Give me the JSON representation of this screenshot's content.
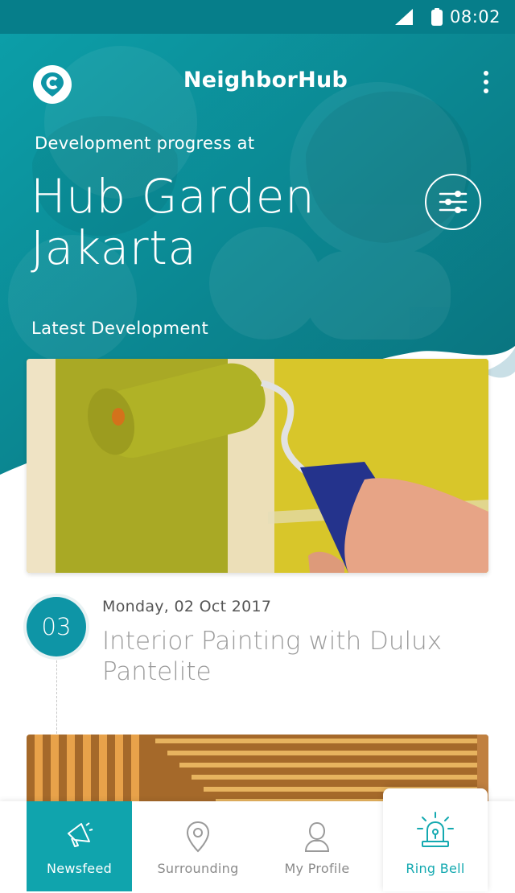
{
  "status_bar": {
    "time": "08:02"
  },
  "header": {
    "app_name": "NeighborHub"
  },
  "hero": {
    "subtitle": "Development progress at",
    "location_line1": "Hub Garden",
    "location_line2": "Jakarta"
  },
  "feed": {
    "section_title": "Latest Development",
    "posts": [
      {
        "day": "03",
        "date": "Monday, 02 Oct 2017",
        "title": "Interior Painting with Dulux Pantelite"
      }
    ]
  },
  "bottom_nav": {
    "items": [
      {
        "label": "Newsfeed",
        "icon": "megaphone-icon",
        "active": true
      },
      {
        "label": "Surrounding",
        "icon": "map-pin-icon"
      },
      {
        "label": "My Profile",
        "icon": "user-icon"
      },
      {
        "label": "Ring Bell",
        "icon": "alarm-siren-icon"
      }
    ]
  },
  "colors": {
    "primary": "#0e95a6",
    "teal_dark": "#067e8a",
    "teal_light": "#10a4ad",
    "bell_accent": "#14a9b0"
  }
}
